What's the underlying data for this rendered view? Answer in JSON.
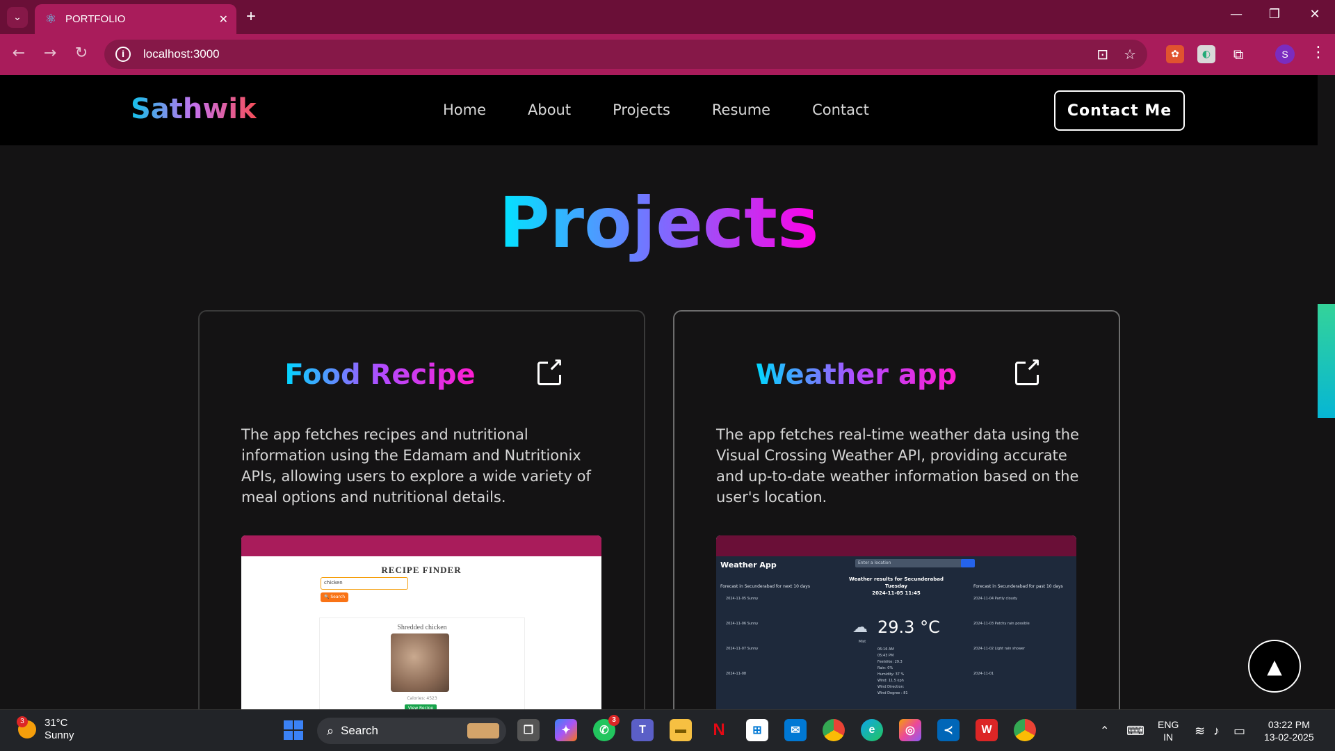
{
  "browser": {
    "tab_title": "PORTFOLIO",
    "new_tab": "+",
    "tab_close": "✕",
    "tab_list": "⌄",
    "url": "localhost:3000",
    "window_controls": [
      "—",
      "❐",
      "✕"
    ],
    "profile_initial": "S"
  },
  "site": {
    "logo": "Sathwik",
    "nav": [
      "Home",
      "About",
      "Projects",
      "Resume",
      "Contact"
    ],
    "contact_button": "Contact Me",
    "page_title": "Projects",
    "back_to_top": "▲"
  },
  "projects": [
    {
      "title": "Food Recipe",
      "description": "The app fetches recipes and nutritional information using the Edamam and Nutritionix APIs, allowing users to explore a wide variety of meal options and nutritional details.",
      "preview": {
        "heading": "RECIPE FINDER",
        "input_value": "chicken",
        "search_label": "🔍 Search",
        "card_title": "Shredded chicken",
        "calories": "Calories: 4523",
        "view_label": "View Recipe"
      }
    },
    {
      "title": "Weather app",
      "description": "The app fetches real-time weather data using the Visual Crossing Weather API, providing accurate and up-to-date weather information based on the user's location.",
      "preview": {
        "heading": "Weather App",
        "input_placeholder": "Enter a location",
        "results_line1": "Weather results for Secunderabad",
        "results_line2": "Tuesday",
        "results_line3": "2024-11-05 11:45",
        "temperature": "29.3 °C",
        "condition": "Mist",
        "left_title": "Forecast in Secunderabad for next 10 days",
        "right_title": "Forecast in Secunderabad for past 10 days",
        "left_rows": [
          "2024-11-05  Sunny",
          "2024-11-06  Sunny",
          "2024-11-07  Sunny",
          "2024-11-08"
        ],
        "right_rows": [
          "2024-11-04  Partly cloudy",
          "2024-11-03  Patchy rain possible",
          "2024-11-02  Light rain shower",
          "2024-11-01"
        ],
        "details": [
          "06:16 AM",
          "05:43 PM",
          "Feelslike: 29.3",
          "Rain: 0%",
          "Humidity: 37 %",
          "Wind: 11.5 kph",
          "Wind Direction:",
          "Wind Degree : 81"
        ]
      }
    }
  ],
  "taskbar": {
    "weather_temp": "31°C",
    "weather_desc": "Sunny",
    "weather_badge": "3",
    "search_label": "Search",
    "whatsapp_badge": "3",
    "lang_1": "ENG",
    "lang_2": "IN",
    "time": "03:22 PM",
    "date": "13-02-2025"
  },
  "colors": {
    "browser_frame": "#6a0f37",
    "browser_toolbar": "#a91c5b",
    "page_bg": "#141314"
  }
}
